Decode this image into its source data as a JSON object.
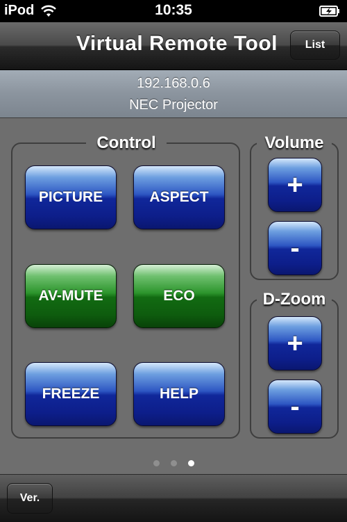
{
  "status_bar": {
    "carrier": "iPod",
    "time": "10:35",
    "wifi_icon": "wifi-icon",
    "battery_icon": "battery-charging-icon"
  },
  "nav": {
    "title": "Virtual Remote Tool",
    "list_label": "List"
  },
  "device": {
    "ip": "192.168.0.6",
    "name": "NEC Projector"
  },
  "control": {
    "label": "Control",
    "buttons": [
      "PICTURE",
      "ASPECT",
      "AV-MUTE",
      "ECO",
      "FREEZE",
      "HELP"
    ]
  },
  "volume": {
    "label": "Volume",
    "plus": "+",
    "minus": "-"
  },
  "dzoom": {
    "label": "D-Zoom",
    "plus": "+",
    "minus": "-"
  },
  "page_indicator": {
    "count": 3,
    "active_index": 2
  },
  "toolbar": {
    "ver_label": "Ver."
  },
  "colors": {
    "blue_button": "#10279a",
    "green_button": "#126b12",
    "background": "#6e6e6e"
  }
}
